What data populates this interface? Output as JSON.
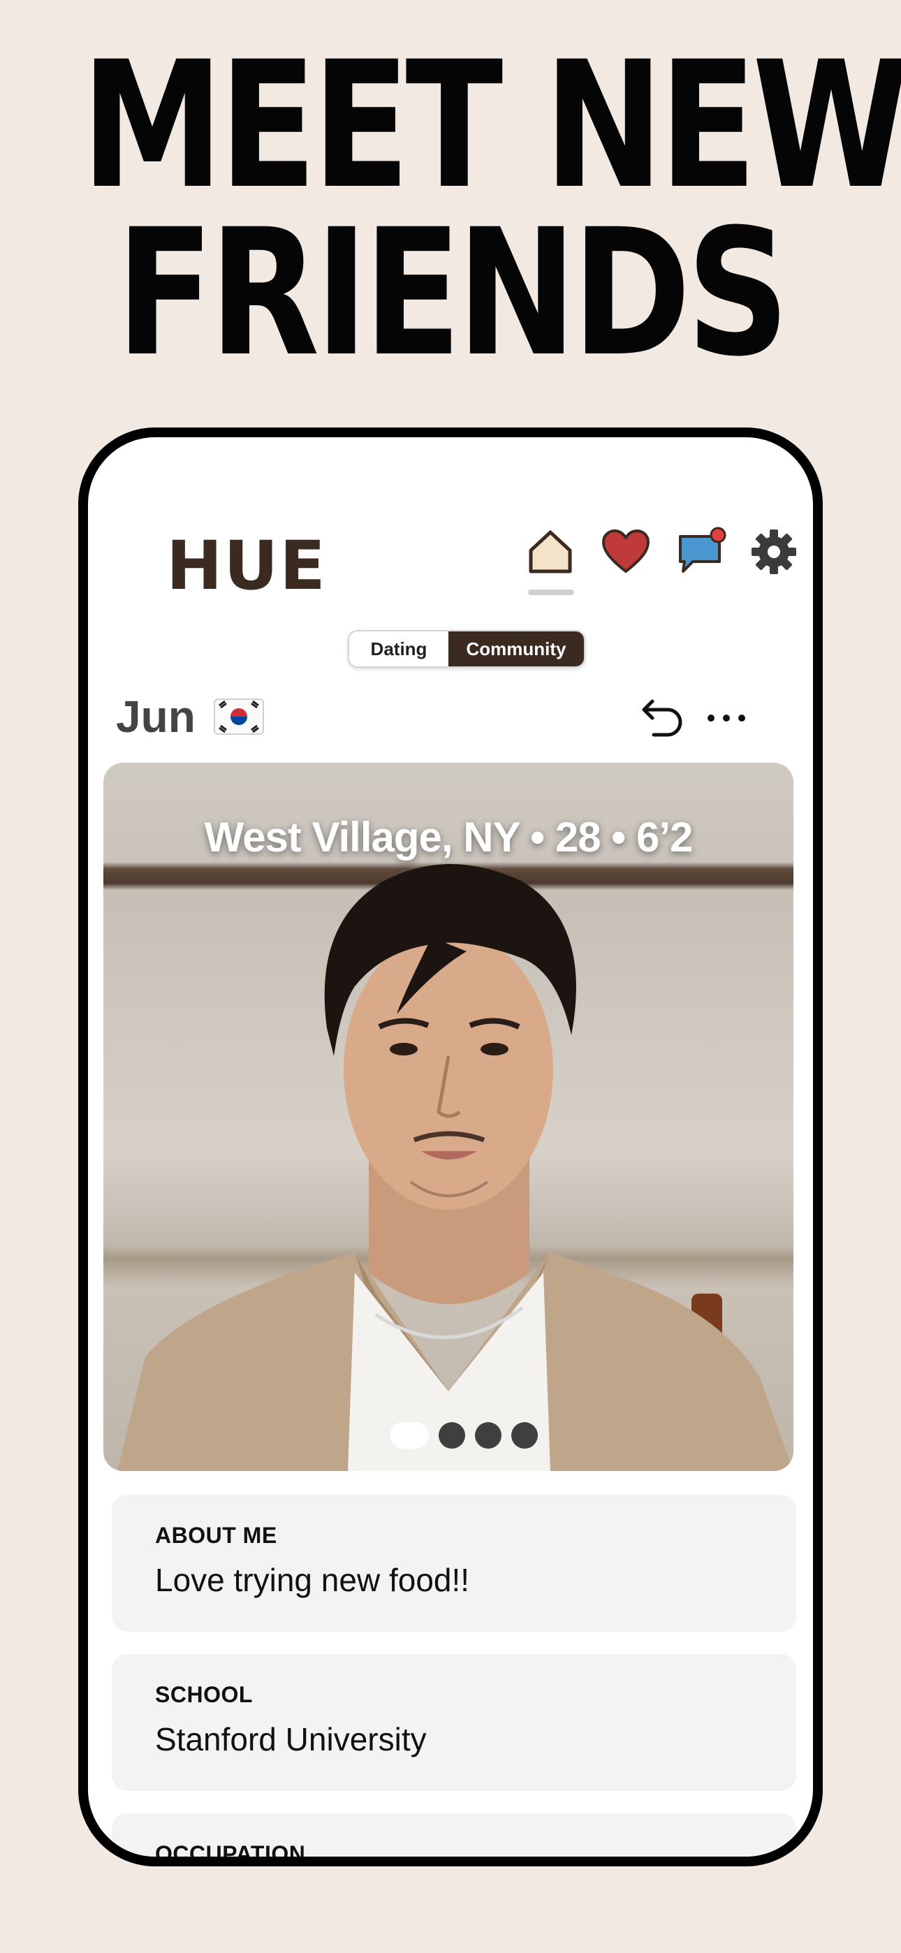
{
  "headline": {
    "line1": "MEET NEW",
    "line2": "FRIENDS"
  },
  "app": {
    "logo": "HUE",
    "nav": {
      "home": "home-icon",
      "likes": "heart-icon",
      "messages": "chat-icon",
      "settings": "gear-icon"
    },
    "colors": {
      "brand": "#3b2a1f",
      "heart": "#c0393b",
      "chat": "#4a96cf",
      "home_fill": "#f5e3c9"
    }
  },
  "segmented": {
    "options": [
      "Dating",
      "Community"
    ],
    "selected": "Community"
  },
  "profile": {
    "name": "Jun",
    "flag": "korea-flag-icon",
    "photo_caption": "West Village, NY • 28 • 6’2",
    "photo_count": 4,
    "photo_index": 1
  },
  "cards": [
    {
      "label": "ABOUT ME",
      "value": "Love trying new food!!"
    },
    {
      "label": "SCHOOL",
      "value": "Stanford University"
    },
    {
      "label": "OCCUPATION",
      "value": ""
    }
  ]
}
